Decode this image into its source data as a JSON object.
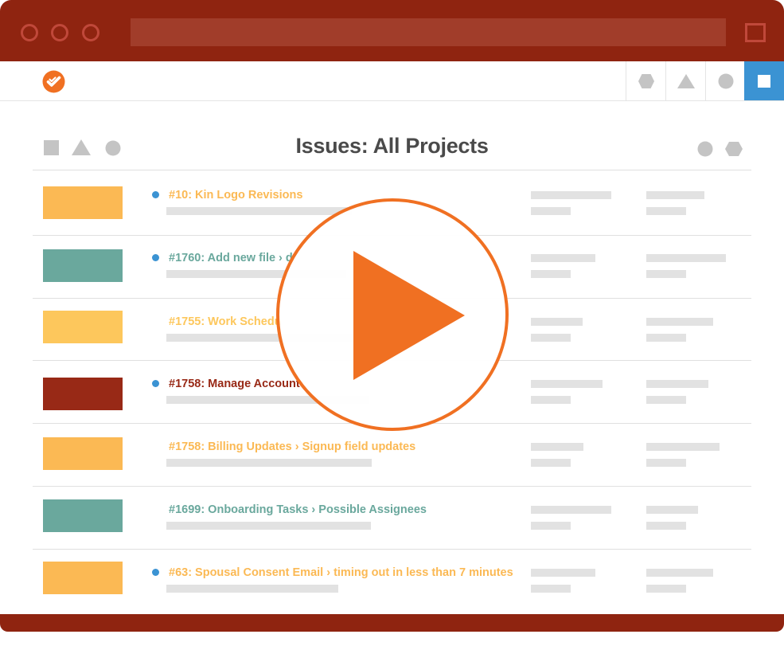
{
  "page": {
    "title": "Issues: All Projects"
  },
  "toolbar": {
    "logo_icon": "check-circle-logo-icon",
    "buttons": [
      {
        "icon": "hexagon-icon"
      },
      {
        "icon": "triangle-icon"
      },
      {
        "icon": "circle-icon"
      },
      {
        "icon": "square-icon",
        "active": true
      }
    ]
  },
  "colors": {
    "chrome": "#8f2410",
    "accent_orange": "#f07022",
    "blue": "#3b93d3",
    "yellow": "#fbb954",
    "teal": "#6aa89d",
    "dark_red": "#982916",
    "gray_text": "#4a4a4a"
  },
  "issues": [
    {
      "title": "#10: Kin Logo Revisions",
      "color": "#fbb954",
      "unread": true
    },
    {
      "title": "#1760: Add new file › d",
      "color": "#6aa89d",
      "unread": true
    },
    {
      "title": "#1755: Work Schedu",
      "color": "#fdc75c",
      "unread": false
    },
    {
      "title": "#1758: Manage Account",
      "color": "#982916",
      "unread": true
    },
    {
      "title": "#1758: Billing Updates › Signup field updates",
      "color": "#fbb954",
      "unread": false
    },
    {
      "title": "#1699: Onboarding Tasks › Possible Assignees",
      "color": "#6aa89d",
      "unread": false
    },
    {
      "title": "#63: Spousal Consent Email › timing out in less than 7 minutes",
      "color": "#fbb954",
      "unread": true
    }
  ],
  "overlay": {
    "icon": "play-button-icon"
  }
}
